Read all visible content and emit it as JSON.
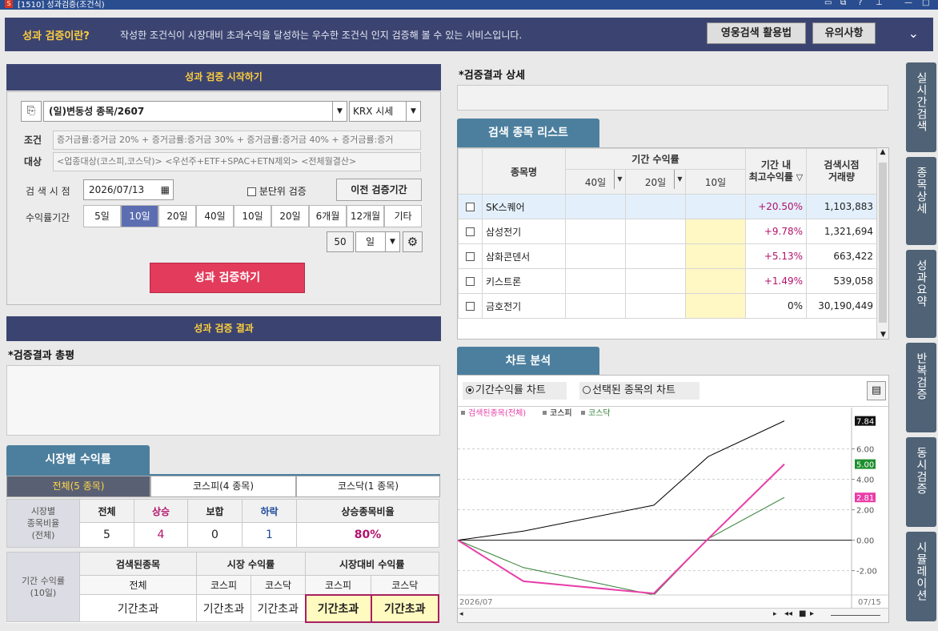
{
  "window": {
    "title": "[1510] 성과검증(조건식)"
  },
  "intro": {
    "lead": "성과 검증이란?",
    "desc": "작성한 조건식이 시장대비 초과수익을 달성하는 우수한 조건식 인지 검증해 볼 수 있는 서비스입니다.",
    "btn_guide": "영웅검색 활용법",
    "btn_notice": "유의사항"
  },
  "start": {
    "header": "성과 검증 시작하기",
    "condition_select": "(일)변동성 종목/2607",
    "market_select": "KRX 시세",
    "cond_label": "조건",
    "cond_text": "증거금률:증거금 20% + 증거금률:증거금 30% + 증거금률:증거금 40% + 증거금률:증거",
    "target_label": "대상",
    "target_text": "<업종대상(코스피,코스닥)> <우선주+ETF+SPAC+ETN제외> <전체월결산>",
    "date_label": "검 색 시 점",
    "date_value": "2026/07/13",
    "minute_label": "분단위 검증",
    "prev_btn": "이전 검증기간",
    "period_label": "수익률기간",
    "periods": [
      "5일",
      "10일",
      "20일",
      "40일",
      "10일",
      "20일",
      "6개월",
      "12개월",
      "기타"
    ],
    "active_period": 1,
    "custom_value": "50",
    "custom_unit": "일",
    "run_btn": "성과 검증하기"
  },
  "result": {
    "header": "성과 검증 결과",
    "summary_title": "*검증결과 총평"
  },
  "market": {
    "tab_title": "시장별 수익률",
    "tabs": [
      "전체(5 종목)",
      "코스피(4 종목)",
      "코스닥(1 종목)"
    ],
    "ratio": {
      "row_label": "시장별\n종목비율\n(전체)",
      "headers": [
        "전체",
        "상승",
        "보합",
        "하락",
        "상승종목비율"
      ],
      "values": [
        "5",
        "4",
        "0",
        "1",
        "80%"
      ]
    },
    "returns": {
      "row_label": "기간 수익률\n(10일)",
      "group_headers": [
        "검색된종목",
        "시장 수익률",
        "시장대비 수익률"
      ],
      "sub_headers": [
        "전체",
        "코스피",
        "코스닥",
        "코스피",
        "코스닥"
      ],
      "values": [
        "기간초과",
        "기간초과",
        "기간초과",
        "기간초과",
        "기간초과"
      ]
    }
  },
  "detail": {
    "title": "*검증결과 상세"
  },
  "stock_list": {
    "tab_title": "검색 종목 리스트",
    "col_name": "종목명",
    "col_period": "기간 수익률",
    "sub_cols": [
      "40일",
      "20일",
      "10일"
    ],
    "col_max": "기간 내\n최고수익률",
    "col_volume": "검색시점\n거래량",
    "rows": [
      {
        "name": "SK스퀘어",
        "max": "+20.50%",
        "volume": "1,103,883"
      },
      {
        "name": "삼성전기",
        "max": "+9.78%",
        "volume": "1,321,694"
      },
      {
        "name": "삼화콘덴서",
        "max": "+5.13%",
        "volume": "663,422"
      },
      {
        "name": "키스트론",
        "max": "+1.49%",
        "volume": "539,058"
      },
      {
        "name": "금호전기",
        "max": "0%",
        "volume": "30,190,449"
      }
    ]
  },
  "chart_panel": {
    "tab_title": "차트 분석",
    "radio1": "기간수익률 차트",
    "radio2": "선택된 종목의 차트",
    "legend": [
      "검색된종목(전체)",
      "코스피",
      "코스닥"
    ],
    "x_start_label": "2026/07",
    "x_end_label": "07/15",
    "y_labels": [
      "6.00",
      "4.00",
      "2.00",
      "0.00",
      "-2.00"
    ],
    "last_values": [
      "7.84",
      "5.00",
      "2.81"
    ]
  },
  "side_tabs": [
    "실시간검색",
    "종목상세",
    "성과요약",
    "반복검증",
    "동시검증",
    "시뮬레이션"
  ],
  "colors": {
    "kospi": "#000000",
    "kosdaq": "#2e7d32",
    "searched": "#e83ea8"
  },
  "chart_data": {
    "type": "line",
    "x": [
      0,
      1,
      2,
      3,
      4
    ],
    "series": [
      {
        "name": "코스피",
        "values": [
          0,
          0.6,
          2.3,
          5.5,
          7.84
        ]
      },
      {
        "name": "코스닥",
        "values": [
          0,
          -1.8,
          -3.6,
          0.1,
          2.81
        ]
      },
      {
        "name": "검색된종목(전체)",
        "values": [
          0,
          -2.7,
          -3.5,
          0.1,
          5.0
        ]
      }
    ],
    "ylim": [
      -3.6,
      8.4
    ],
    "yticks": [
      -2,
      0,
      2,
      4,
      6
    ]
  }
}
